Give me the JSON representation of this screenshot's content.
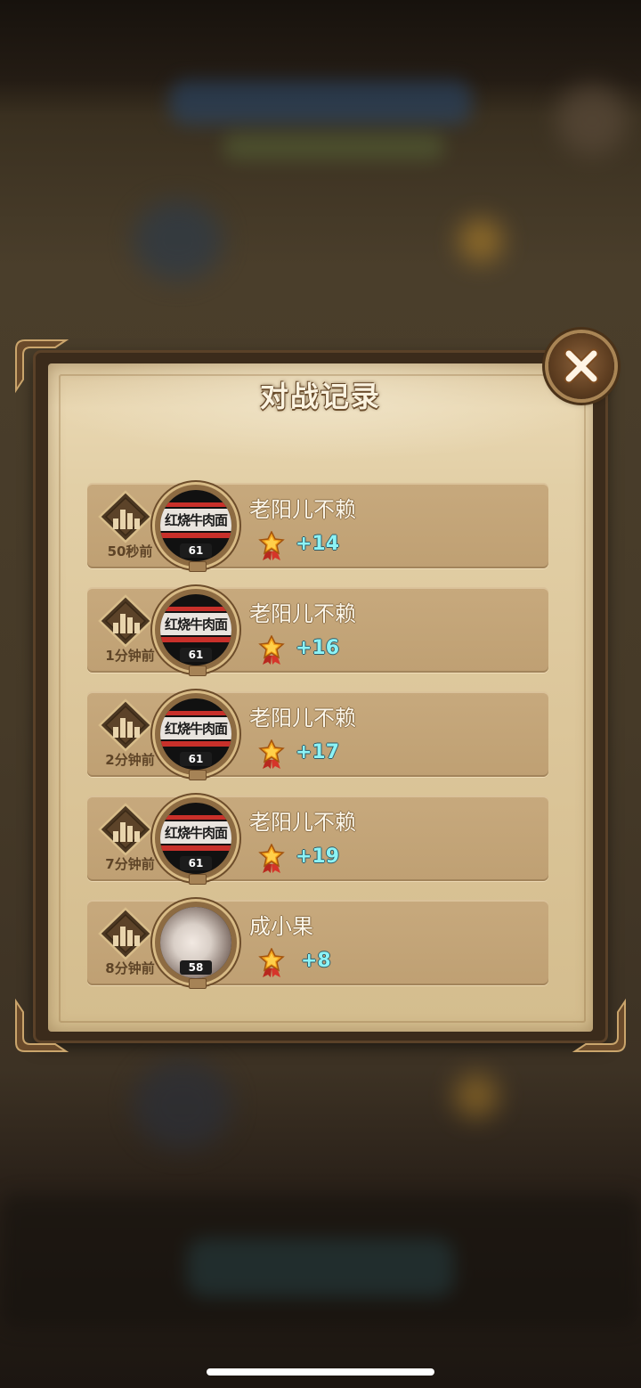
{
  "dialog": {
    "title": "对战记录"
  },
  "records": [
    {
      "time": "50秒前",
      "player": "老阳儿不赖",
      "avatar_text": "红烧牛肉面",
      "level": "61",
      "score": "+14",
      "avatar_type": "flag"
    },
    {
      "time": "1分钟前",
      "player": "老阳儿不赖",
      "avatar_text": "红烧牛肉面",
      "level": "61",
      "score": "+16",
      "avatar_type": "flag"
    },
    {
      "time": "2分钟前",
      "player": "老阳儿不赖",
      "avatar_text": "红烧牛肉面",
      "level": "61",
      "score": "+17",
      "avatar_type": "flag"
    },
    {
      "time": "7分钟前",
      "player": "老阳儿不赖",
      "avatar_text": "红烧牛肉面",
      "level": "61",
      "score": "+19",
      "avatar_type": "flag"
    },
    {
      "time": "8分钟前",
      "player": "成小果",
      "avatar_text": "",
      "level": "58",
      "score": "+8",
      "avatar_type": "photo"
    }
  ],
  "colors": {
    "score": "#8cf3f6",
    "paper": "#e2cfa6",
    "row": "#c7a97d"
  },
  "icons": {
    "close": "close-x-icon",
    "rank": "rank-bars-icon",
    "medal": "medal-star-icon"
  }
}
